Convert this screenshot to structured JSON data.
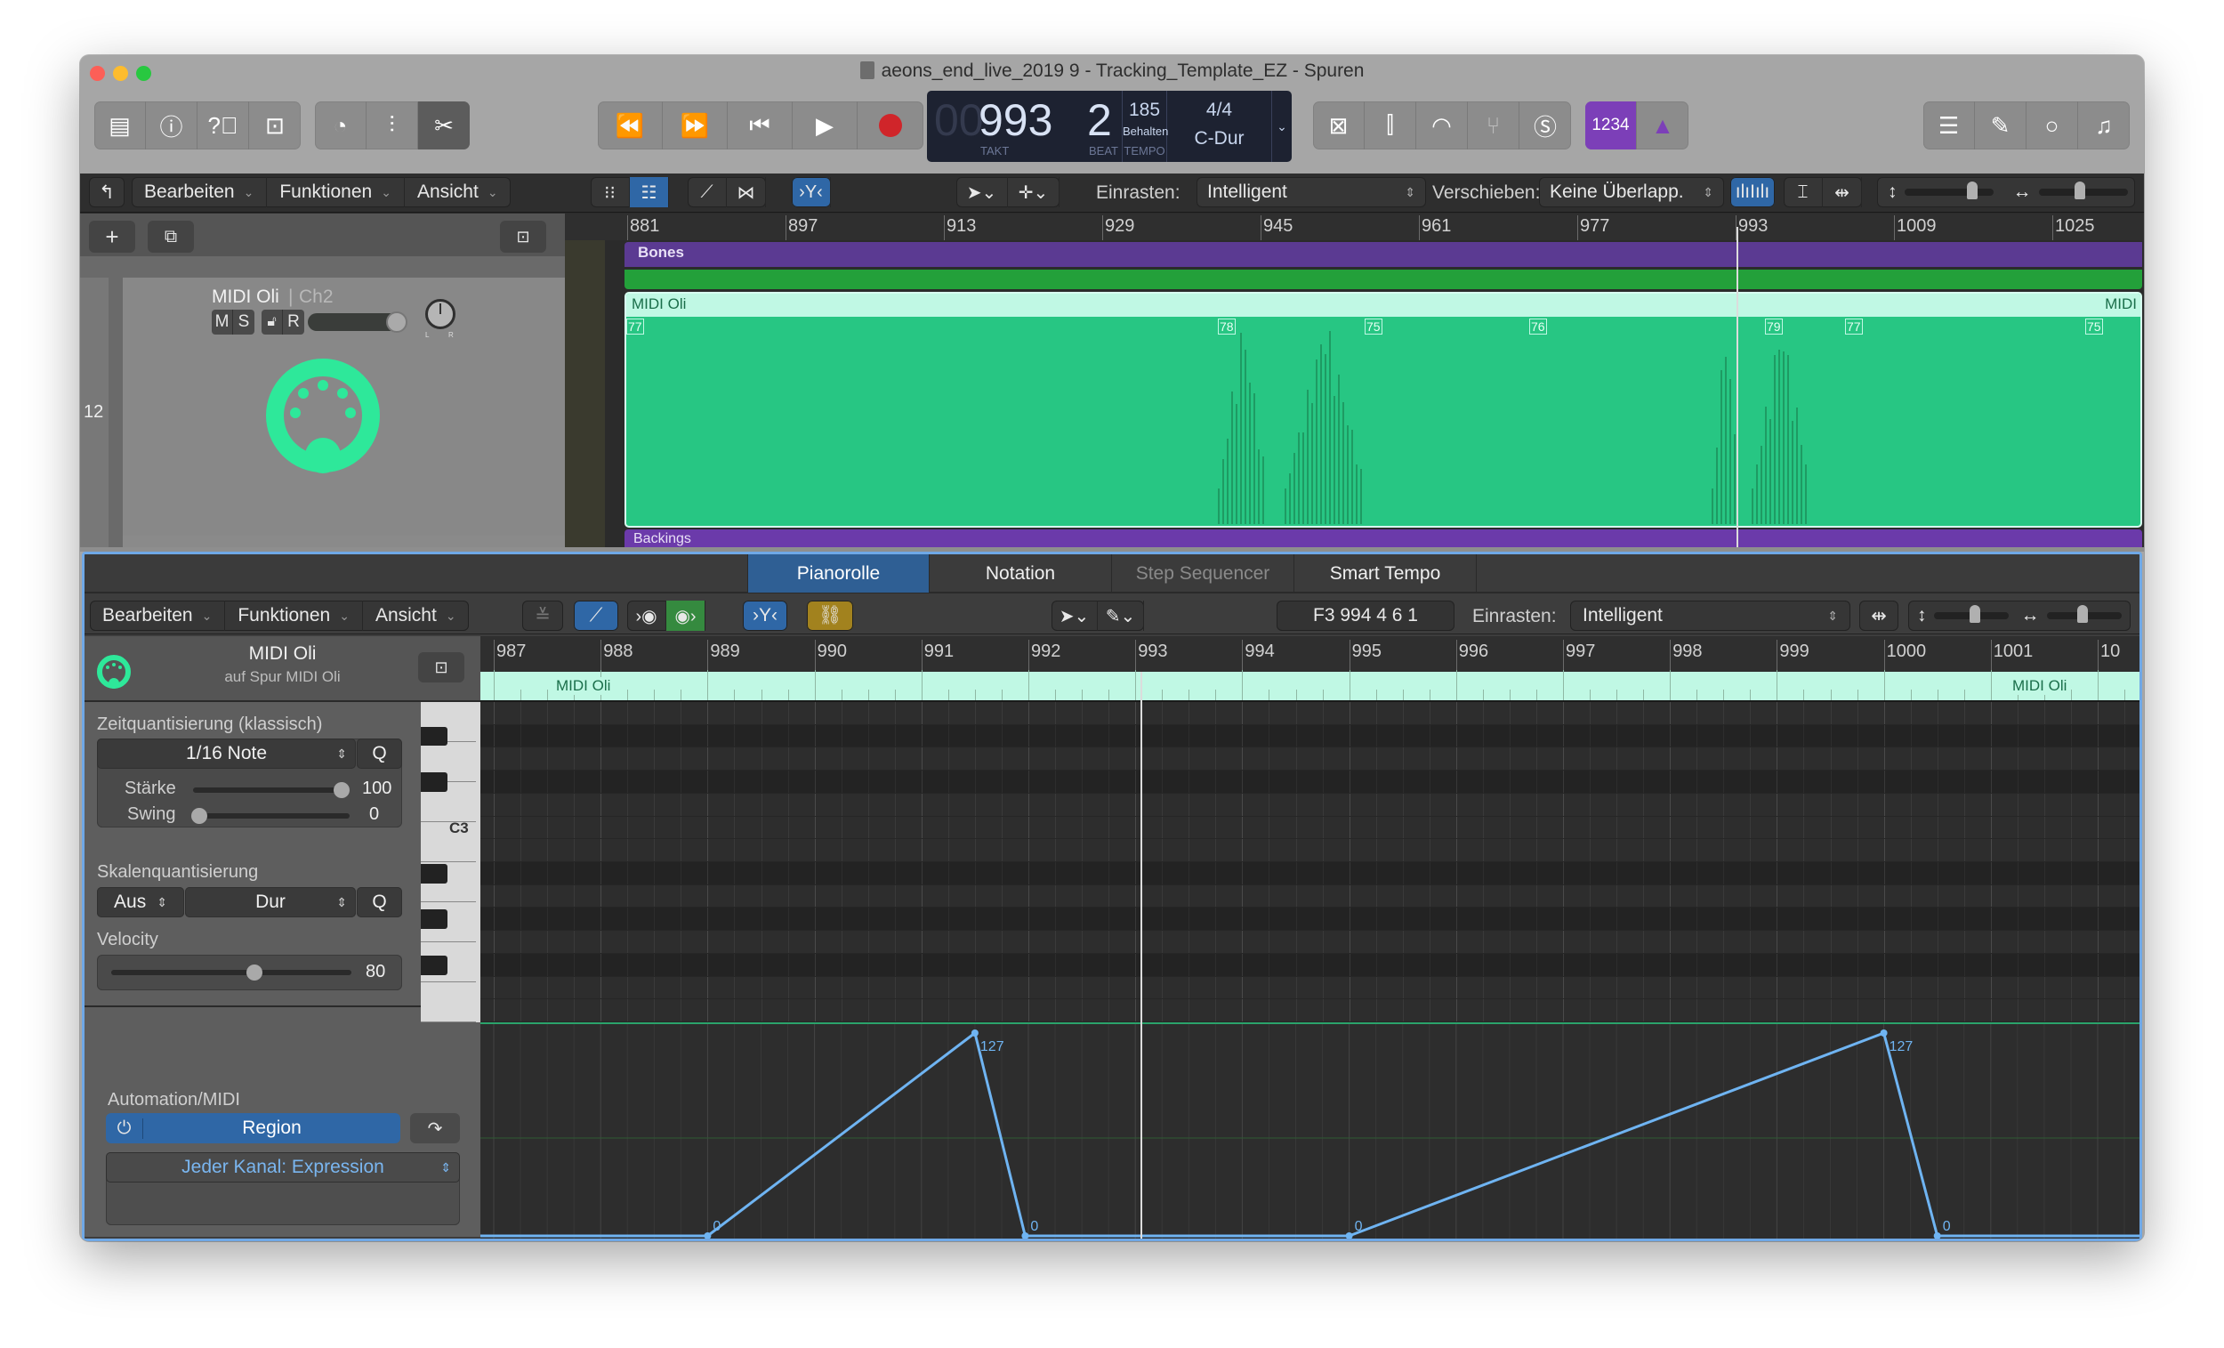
{
  "window": {
    "title": "aeons_end_live_2019 9 - Tracking_Template_EZ - Spuren",
    "traffic_lights": {
      "close": "#fc5f57",
      "minimize": "#fdbc2e",
      "zoom": "#28c840"
    }
  },
  "toolbar": {
    "left_group": [
      "library-icon",
      "info-icon",
      "help-icon",
      "toolbar-toggle-icon"
    ],
    "edit_group": [
      "smart-controls-icon",
      "mixer-icon",
      "scissors-icon"
    ],
    "transport": [
      "rewind-icon",
      "fast-forward-icon",
      "go-to-start-icon",
      "play-icon",
      "record-icon"
    ],
    "lcd": {
      "bar_prefix": "00",
      "bar": "993",
      "beat": "2",
      "bar_label": "TAKT",
      "beat_label": "BEAT",
      "tempo": "185",
      "tempo_mode": "Behalten",
      "tempo_label": "TEMPO",
      "signature": "4/4",
      "key": "C-Dur"
    },
    "mode_group": [
      "replace-icon",
      "tuner-mixer-icon",
      "performance-meter-icon",
      "tuning-fork-icon",
      "solo-icon"
    ],
    "count_in_label": "1234",
    "metronome": "metronome-icon",
    "right_group": [
      "list-icon",
      "notepad-icon",
      "loop-browser-icon",
      "media-browser-icon"
    ],
    "accent_purple": "#7c3fb8",
    "accent_blue": "#2f67a6"
  },
  "tracks_area": {
    "menus": [
      "Bearbeiten",
      "Funktionen",
      "Ansicht"
    ],
    "snap_label": "Einrasten:",
    "snap_value": "Intelligent",
    "drag_label": "Verschieben:",
    "drag_value": "Keine Überlapp.",
    "ruler": [
      "881",
      "897",
      "913",
      "929",
      "945",
      "961",
      "977",
      "993",
      "1009",
      "1025"
    ],
    "track": {
      "number": "12",
      "name": "MIDI Oli",
      "channel": "Ch2",
      "buttons": [
        "M",
        "S",
        "R"
      ],
      "pan_labels": [
        "L",
        "R"
      ],
      "volume_fraction": 0.95
    },
    "regions": {
      "top": {
        "name": "Bones",
        "color": "#5b3a92"
      },
      "midi": {
        "name": "MIDI Oli",
        "name_right": "MIDI",
        "color": "#27c683",
        "header_color": "#c0f8e4"
      },
      "bottom": {
        "name": "Backings",
        "color": "#6b3aaa"
      },
      "velocity_labels": [
        "77",
        "78",
        "75",
        "76",
        "79",
        "77",
        "75"
      ]
    }
  },
  "piano_roll": {
    "tabs": [
      {
        "label": "Pianorolle",
        "active": true
      },
      {
        "label": "Notation",
        "active": false
      },
      {
        "label": "Step Sequencer",
        "active": false,
        "dimmed": true
      },
      {
        "label": "Smart Tempo",
        "active": false
      }
    ],
    "menus": [
      "Bearbeiten",
      "Funktionen",
      "Ansicht"
    ],
    "position_readout": "F3   994 4 6 1",
    "snap_label": "Einrasten:",
    "snap_value": "Intelligent",
    "ruler": [
      "987",
      "988",
      "989",
      "990",
      "991",
      "992",
      "993",
      "994",
      "995",
      "996",
      "997",
      "998",
      "999",
      "1000",
      "1001",
      "10"
    ],
    "region_name": "MIDI Oli",
    "key_label": "C3",
    "inspector": {
      "region_name": "MIDI Oli",
      "region_sub": "auf Spur MIDI Oli",
      "time_quant_label": "Zeitquantisierung (klassisch)",
      "time_quant_value": "1/16 Note",
      "q_label": "Q",
      "strength_label": "Stärke",
      "strength_value": "100",
      "swing_label": "Swing",
      "swing_value": "0",
      "scale_quant_label": "Skalenquantisierung",
      "scale_root": "Aus",
      "scale_type": "Dur",
      "velocity_label": "Velocity",
      "velocity_value": "80",
      "automation_label": "Automation/MIDI",
      "automation_mode": "Region",
      "automation_param": "Jeder Kanal: Expression"
    },
    "automation": {
      "line_color": "#6fb4f2",
      "range": [
        0,
        127
      ],
      "points": [
        {
          "bar": 989.0,
          "value": 0
        },
        {
          "bar": 991.5,
          "value": 127
        },
        {
          "bar": 991.97,
          "value": 0
        },
        {
          "bar": 995.0,
          "value": 0
        },
        {
          "bar": 1000.0,
          "value": 127
        },
        {
          "bar": 1000.5,
          "value": 0
        }
      ]
    }
  },
  "playhead_bar": 993.05
}
